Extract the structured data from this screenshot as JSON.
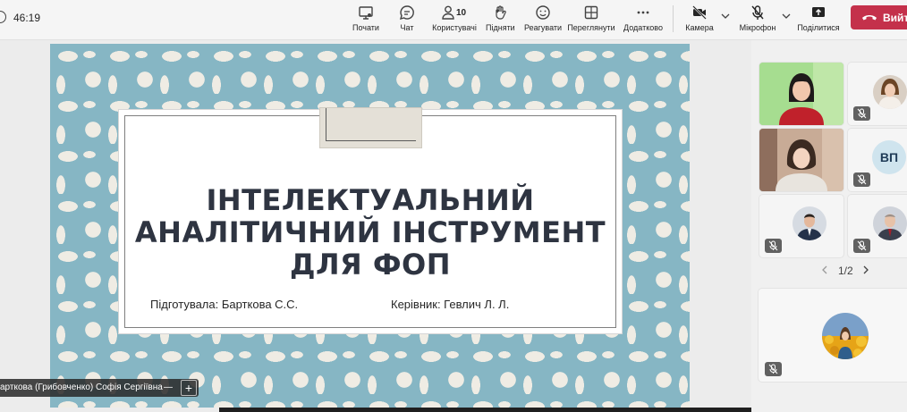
{
  "meeting": {
    "timer": "46:19",
    "participant_count": "10",
    "toolbar": {
      "chat_prev": "Почати",
      "chat": "Чат",
      "people": "Користувачі",
      "raise": "Підняти",
      "react": "Реагувати",
      "view": "Переглянути",
      "more": "Додатково",
      "camera": "Камера",
      "mic": "Мікрофон",
      "share": "Поділитися",
      "leave": "Вийти"
    }
  },
  "slide": {
    "title_lines": [
      "ІНТЕЛЕКТУАЛЬНИЙ",
      "АНАЛІТИЧНИЙ ІНСТРУМЕНТ",
      "ДЛЯ ФОП"
    ],
    "author": "Підготувала: Барткова С.С.",
    "supervisor": "Керівник: Гевлич Л. Л.",
    "pattern_colors": {
      "background": "#86b6c4",
      "shapes": "#efece4"
    }
  },
  "presenter_chip": {
    "name": "арткова (Грибовченко) Софія Сергіївна",
    "minus": "—",
    "plus": "+"
  },
  "participants": {
    "tiles": [
      {
        "kind": "video",
        "muted": false
      },
      {
        "kind": "photo",
        "muted": true
      },
      {
        "kind": "video",
        "muted": false
      },
      {
        "kind": "initials",
        "initials": "ВП",
        "muted": true
      },
      {
        "kind": "photo",
        "muted": true
      },
      {
        "kind": "photo",
        "muted": true
      }
    ],
    "pager": "1/2",
    "self_muted": true
  },
  "colors": {
    "leave": "#c4314b",
    "toolbar_bg": "#f5f5f5",
    "title_text": "#2e3441"
  }
}
